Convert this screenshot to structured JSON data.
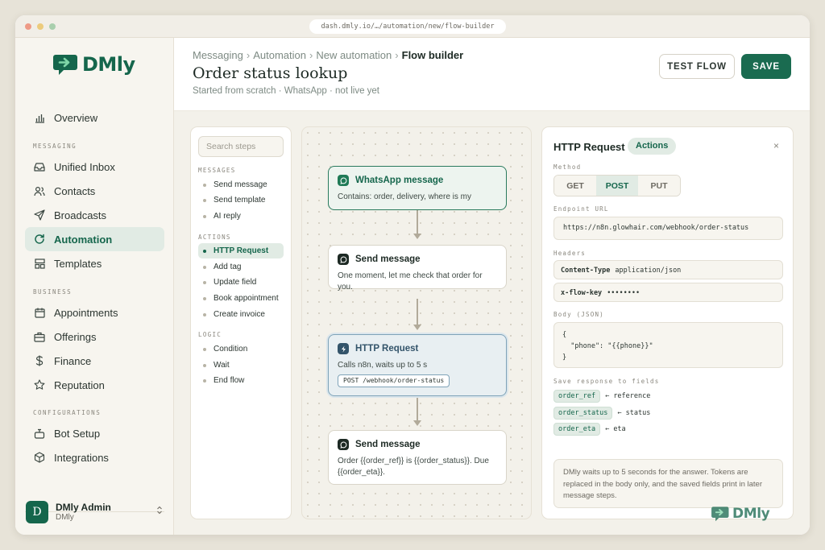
{
  "browser": {
    "url": "dash.dmly.io/…/automation/new/flow-builder",
    "dots": [
      "#ee9a86",
      "#eccb7c",
      "#a9cfad"
    ]
  },
  "brand": {
    "name": "DMly",
    "color": "#15664c",
    "icon": "chat-arrow-logo-icon"
  },
  "sidebar": {
    "top_item": {
      "label": "Overview",
      "icon": "bar-chart-icon"
    },
    "sections": [
      {
        "label": "MESSAGING",
        "items": [
          {
            "label": "Unified Inbox",
            "icon": "inbox-icon"
          },
          {
            "label": "Contacts",
            "icon": "users-icon"
          },
          {
            "label": "Broadcasts",
            "icon": "send-icon"
          },
          {
            "label": "Automation",
            "icon": "refresh-icon",
            "active": true
          },
          {
            "label": "Templates",
            "icon": "layout-icon"
          }
        ]
      },
      {
        "label": "BUSINESS",
        "items": [
          {
            "label": "Appointments",
            "icon": "calendar-icon"
          },
          {
            "label": "Offerings",
            "icon": "briefcase-icon"
          },
          {
            "label": "Finance",
            "icon": "dollar-icon"
          },
          {
            "label": "Reputation",
            "icon": "star-icon"
          }
        ]
      },
      {
        "label": "CONFIGURATIONS",
        "items": [
          {
            "label": "Bot Setup",
            "icon": "bot-icon"
          },
          {
            "label": "Integrations",
            "icon": "cube-icon"
          }
        ]
      }
    ],
    "profile": {
      "initial": "D",
      "name": "DMly Admin",
      "sub": "DMly"
    }
  },
  "header": {
    "breadcrumbs": [
      "Messaging",
      "Automation",
      "New automation"
    ],
    "breadcrumb_current": "Flow builder",
    "title": "Order status lookup",
    "subtitle": "Started from scratch · WhatsApp · not live yet",
    "test_label": "TEST FLOW",
    "save_label": "SAVE"
  },
  "palette": {
    "search_placeholder": "Search steps",
    "groups": [
      {
        "label": "MESSAGES",
        "items": [
          "Send message",
          "Send template",
          "AI reply"
        ]
      },
      {
        "label": "ACTIONS",
        "items": [
          "HTTP Request",
          "Add tag",
          "Update field",
          "Book appointment",
          "Create invoice"
        ],
        "active_index": 0
      },
      {
        "label": "LOGIC",
        "items": [
          "Condition",
          "Wait",
          "End flow"
        ]
      }
    ]
  },
  "flow": {
    "nodes": [
      {
        "type": "whatsapp",
        "title": "WhatsApp message",
        "body": "Contains: order, delivery, where is my",
        "icon": "whatsapp-icon"
      },
      {
        "type": "message",
        "title": "Send message",
        "body": "One moment, let me check that order for you.",
        "icon": "chat-bubble-icon"
      },
      {
        "type": "http",
        "title": "HTTP Request",
        "body": "Calls n8n, waits up to 5 s",
        "code": "POST /webhook/order-status",
        "icon": "bolt-icon"
      },
      {
        "type": "message",
        "title": "Send message",
        "body": "Order {{order_ref}} is {{order_status}}. Due {{order_eta}}.",
        "icon": "chat-bubble-icon"
      }
    ]
  },
  "config": {
    "title": "HTTP Request",
    "badge": "Actions",
    "close": "×",
    "method_label": "Method",
    "methods": [
      "GET",
      "POST",
      "PUT"
    ],
    "method_selected": "POST",
    "endpoint_label": "Endpoint URL",
    "endpoint": "https://n8n.glowhair.com/webhook/order-status",
    "headers_label": "Headers",
    "headers": [
      {
        "key": "Content-Type",
        "value": "application/json"
      },
      {
        "key": "x-flow-key",
        "value": "••••••••"
      }
    ],
    "body_label": "Body (JSON)",
    "body": "{\n  \"phone\": \"{{phone}}\"\n}",
    "save_label": "Save response to fields",
    "mappings": [
      {
        "field": "order_ref",
        "arrow": "←",
        "source": "reference"
      },
      {
        "field": "order_status",
        "arrow": "←",
        "source": "status"
      },
      {
        "field": "order_eta",
        "arrow": "←",
        "source": "eta"
      }
    ],
    "note": "DMly waits up to 5 seconds for the answer. Tokens are replaced in the body only, and the saved fields print in later message steps."
  }
}
